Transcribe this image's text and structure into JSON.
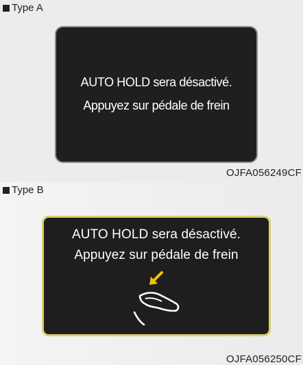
{
  "panel_a": {
    "type_label": "Type A",
    "message_line1": "AUTO HOLD sera désactivé.",
    "message_line2": "Appuyez sur pédale de frein",
    "figure_code": "OJFA056249CF"
  },
  "panel_b": {
    "type_label": "Type B",
    "message_line1": "AUTO HOLD sera désactivé.",
    "message_line2": "Appuyez sur pédale de frein",
    "icon": "brake-pedal-press-icon",
    "figure_code": "OJFA056250CF"
  },
  "colors": {
    "screen_background": "#201f1f",
    "screen_text": "#ffffff",
    "type_b_border": "#d6cf6a",
    "arrow": "#f2c400"
  }
}
